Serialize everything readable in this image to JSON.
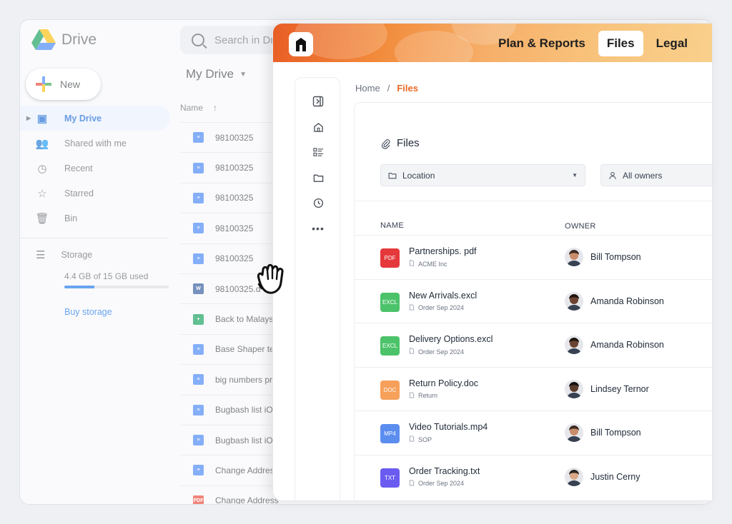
{
  "drive": {
    "brand": "Drive",
    "search_placeholder": "Search in Dr",
    "new_label": "New",
    "nav": [
      {
        "label": "My Drive",
        "icon": "drive-icon",
        "glyph": "▣"
      },
      {
        "label": "Shared with me",
        "icon": "people-icon",
        "glyph": "👥"
      },
      {
        "label": "Recent",
        "icon": "clock-icon",
        "glyph": "◷"
      },
      {
        "label": "Starred",
        "icon": "star-icon",
        "glyph": "☆"
      },
      {
        "label": "Bin",
        "icon": "trash-icon",
        "glyph": "🗑"
      }
    ],
    "storage": {
      "label": "Storage",
      "used_text": "4.4 GB of 15 GB used",
      "used_fraction": 0.29,
      "buy_label": "Buy storage"
    },
    "heading": "My Drive",
    "column_name": "Name",
    "files": [
      {
        "name": "98100325",
        "type": "doc",
        "glyph": "≡"
      },
      {
        "name": "98100325",
        "type": "doc",
        "glyph": "≡"
      },
      {
        "name": "98100325",
        "type": "doc",
        "glyph": "≡"
      },
      {
        "name": "98100325",
        "type": "doc",
        "glyph": "≡"
      },
      {
        "name": "98100325",
        "type": "doc",
        "glyph": "≡"
      },
      {
        "name": "98100325.d",
        "type": "word",
        "glyph": "W"
      },
      {
        "name": "Back to Malays",
        "type": "sheet",
        "glyph": "+"
      },
      {
        "name": "Base Shaper te",
        "type": "doc",
        "glyph": "≡"
      },
      {
        "name": "big numbers pr",
        "type": "doc",
        "glyph": "≡"
      },
      {
        "name": "Bugbash list iO",
        "type": "doc",
        "glyph": "≡"
      },
      {
        "name": "Bugbash list iO",
        "type": "doc",
        "glyph": "≡"
      },
      {
        "name": "Change Addres",
        "type": "doc",
        "glyph": "≡"
      },
      {
        "name": "Change Address",
        "type": "pdf",
        "glyph": "PDF"
      }
    ]
  },
  "app": {
    "tabs": [
      {
        "label": "Plan & Reports",
        "active": false
      },
      {
        "label": "Files",
        "active": true
      },
      {
        "label": "Legal",
        "active": false
      }
    ],
    "breadcrumb": {
      "home": "Home",
      "separator": "/",
      "current": "Files"
    },
    "title": "Files",
    "filters": {
      "location": "Location",
      "owners": "All owners"
    },
    "columns": {
      "name": "NAME",
      "owner": "OWNER"
    },
    "files": [
      {
        "name": "Partnerships. pdf",
        "sub": "ACME Inc",
        "badge": "PDF",
        "badge_color": "#e5383b",
        "owner": "Bill Tompson",
        "skin": "#c98d6b",
        "hair": "#3b2a20"
      },
      {
        "name": "New Arrivals.excl",
        "sub": "Order Sep 2024",
        "badge": "EXCL",
        "badge_color": "#4cc36a",
        "owner": "Amanda Robinson",
        "skin": "#6b4431",
        "hair": "#1e1410"
      },
      {
        "name": "Delivery Options.excl",
        "sub": "Order Sep 2024",
        "badge": "EXCL",
        "badge_color": "#4cc36a",
        "owner": "Amanda Robinson",
        "skin": "#6b4431",
        "hair": "#1e1410"
      },
      {
        "name": "Return Policy.doc",
        "sub": "Return",
        "badge": "DOC",
        "badge_color": "#f6a05a",
        "owner": "Lindsey Ternor",
        "skin": "#5a3a2a",
        "hair": "#151010"
      },
      {
        "name": "Video Tutorials.mp4",
        "sub": "SOP",
        "badge": "MP4",
        "badge_color": "#5b8def",
        "owner": "Bill Tompson",
        "skin": "#c98d6b",
        "hair": "#3b2a20"
      },
      {
        "name": "Order Tracking.txt",
        "sub": "Order Sep 2024",
        "badge": "TXT",
        "badge_color": "#6a5cf0",
        "owner": "Justin Cerny",
        "skin": "#d8a888",
        "hair": "#2a2420"
      }
    ]
  }
}
